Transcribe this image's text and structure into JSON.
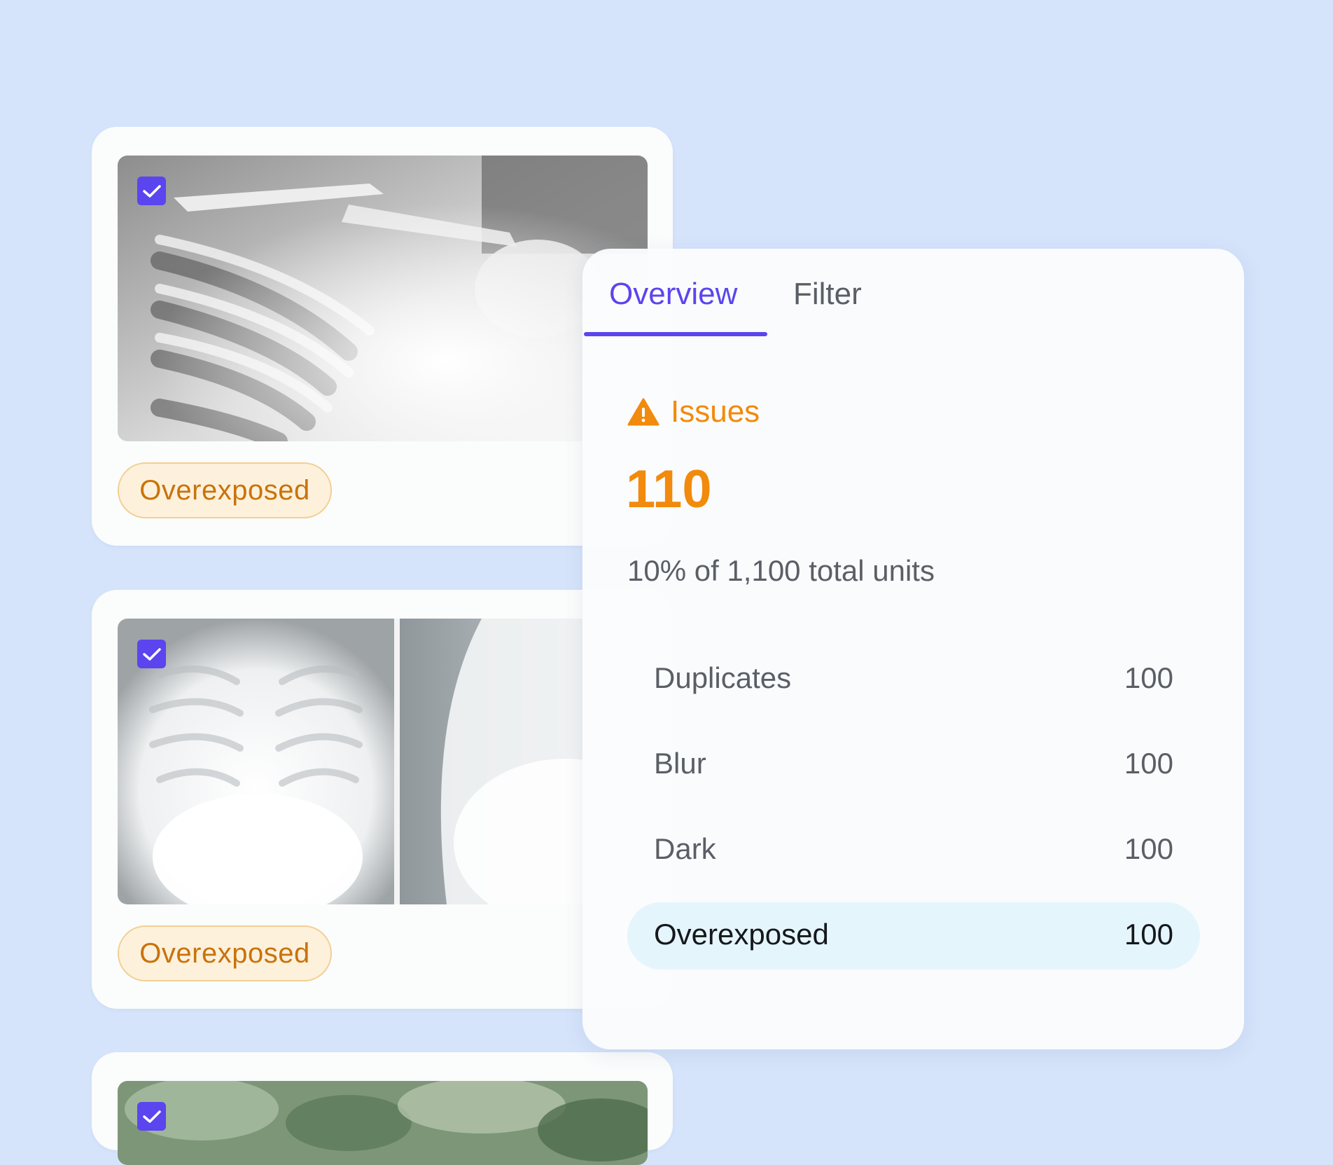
{
  "colors": {
    "background": "#d5e4fb",
    "accent": "#5b45ee",
    "warning": "#f28a0d",
    "tag_text": "#c9730b",
    "tag_bg": "#fdf1dc",
    "selected_row_bg": "#e5f5fc"
  },
  "cards": [
    {
      "checked": true,
      "image": "x-ray-shoulder",
      "tag": "Overexposed"
    },
    {
      "checked": true,
      "image": "x-ray-chest",
      "tag": "Overexposed"
    },
    {
      "checked": true,
      "image": "foliage-photo"
    }
  ],
  "panel": {
    "tabs": [
      {
        "label": "Overview",
        "active": true
      },
      {
        "label": "Filter",
        "active": false
      }
    ],
    "issues_label": "Issues",
    "issues_icon": "warning-triangle-icon",
    "issues_count": "110",
    "summary": "10% of 1,100 total units",
    "rows": [
      {
        "label": "Duplicates",
        "value": "100"
      },
      {
        "label": "Blur",
        "value": "100"
      },
      {
        "label": "Dark",
        "value": "100"
      },
      {
        "label": "Overexposed",
        "value": "100",
        "selected": true
      }
    ]
  }
}
